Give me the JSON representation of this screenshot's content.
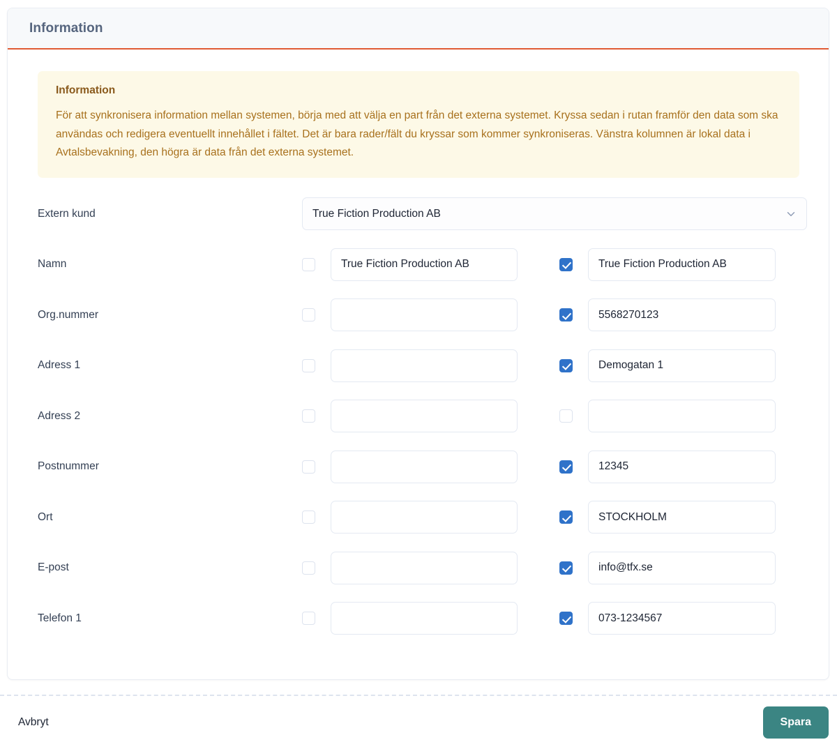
{
  "card": {
    "title": "Information"
  },
  "alert": {
    "title": "Information",
    "text": "För att synkronisera information mellan systemen, börja med att välja en part från det externa systemet. Kryssa sedan i rutan framför den data som ska användas och redigera eventuellt innehållet i fältet. Det är bara rader/fält du kryssar som kommer synkroniseras. Vänstra kolumnen är lokal data i Avtalsbevakning, den högra är data från det externa systemet."
  },
  "select_row": {
    "label": "Extern kund",
    "value": "True Fiction Production AB",
    "icon": "chevron-down-icon"
  },
  "rows": [
    {
      "label": "Namn",
      "left": {
        "checked": false,
        "value": "True Fiction Production AB"
      },
      "right": {
        "checked": true,
        "value": "True Fiction Production AB"
      }
    },
    {
      "label": "Org.nummer",
      "left": {
        "checked": false,
        "value": ""
      },
      "right": {
        "checked": true,
        "value": "5568270123"
      }
    },
    {
      "label": "Adress 1",
      "left": {
        "checked": false,
        "value": ""
      },
      "right": {
        "checked": true,
        "value": "Demogatan 1"
      }
    },
    {
      "label": "Adress 2",
      "left": {
        "checked": false,
        "value": ""
      },
      "right": {
        "checked": false,
        "value": ""
      }
    },
    {
      "label": "Postnummer",
      "left": {
        "checked": false,
        "value": ""
      },
      "right": {
        "checked": true,
        "value": "12345"
      }
    },
    {
      "label": "Ort",
      "left": {
        "checked": false,
        "value": ""
      },
      "right": {
        "checked": true,
        "value": "STOCKHOLM"
      }
    },
    {
      "label": "E-post",
      "left": {
        "checked": false,
        "value": ""
      },
      "right": {
        "checked": true,
        "value": "info@tfx.se"
      }
    },
    {
      "label": "Telefon 1",
      "left": {
        "checked": false,
        "value": ""
      },
      "right": {
        "checked": true,
        "value": "073-1234567"
      }
    }
  ],
  "footer": {
    "cancel_label": "Avbryt",
    "save_label": "Spara"
  },
  "colors": {
    "header_accent": "#e05a33",
    "alert_bg": "#fdf9e7",
    "alert_text": "#a8711d",
    "checkbox_checked": "#2f72c9",
    "save_button": "#3b8583",
    "title_text": "#56657e"
  }
}
